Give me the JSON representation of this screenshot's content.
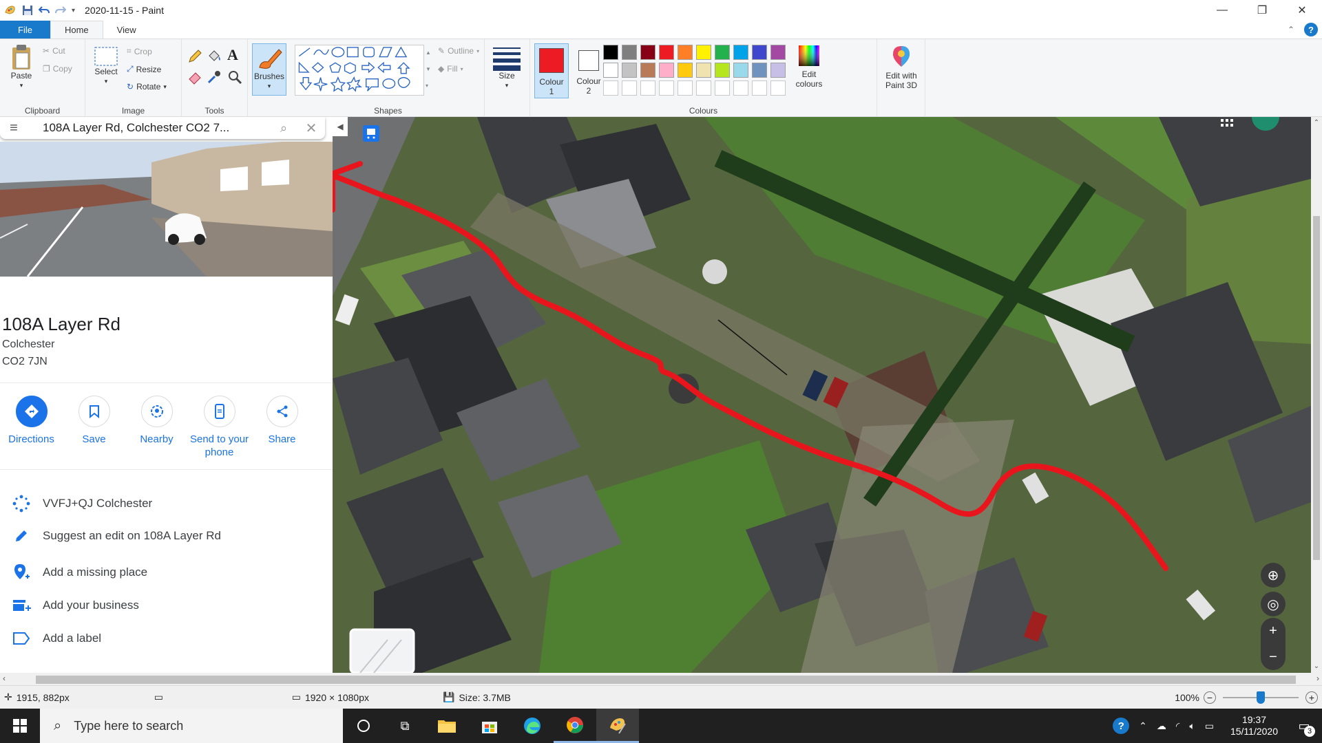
{
  "window": {
    "title": "2020-11-15 - Paint",
    "controls": [
      "—",
      "❐",
      "✕"
    ]
  },
  "tabs": {
    "file": "File",
    "home": "Home",
    "view": "View"
  },
  "ribbon": {
    "clipboard": {
      "label": "Clipboard",
      "paste": "Paste",
      "cut": "Cut",
      "copy": "Copy"
    },
    "image": {
      "label": "Image",
      "select": "Select",
      "crop": "Crop",
      "resize": "Resize",
      "rotate": "Rotate"
    },
    "tools": {
      "label": "Tools"
    },
    "brushes": "Brushes",
    "shapes": {
      "label": "Shapes",
      "outline": "Outline",
      "fill": "Fill"
    },
    "size": "Size",
    "colours": {
      "label": "Colours",
      "colour1_a": "Colour",
      "colour1_b": "1",
      "colour2_a": "Colour",
      "colour2_b": "2",
      "edit_a": "Edit",
      "edit_b": "colours",
      "paint3d_a": "Edit with",
      "paint3d_b": "Paint 3D",
      "colour1_value": "#ed1c24",
      "colour2_value": "#ffffff",
      "palette_row1": [
        "#000000",
        "#7f7f7f",
        "#880015",
        "#ed1c24",
        "#ff7f27",
        "#fff200",
        "#22b14c",
        "#00a2e8",
        "#3f48cc",
        "#a349a4"
      ],
      "palette_row2": [
        "#ffffff",
        "#c3c3c3",
        "#b97a57",
        "#ffaec9",
        "#ffc90e",
        "#efe4b0",
        "#b5e61d",
        "#99d9ea",
        "#7092be",
        "#c8bfe7"
      ]
    }
  },
  "maps": {
    "search_value": "108A Layer Rd, Colchester CO2 7...",
    "place_name": "108A Layer Rd",
    "town": "Colchester",
    "postcode": "CO2 7JN",
    "actions": [
      {
        "label": "Directions"
      },
      {
        "label": "Save"
      },
      {
        "label": "Nearby"
      },
      {
        "label": "Send to your phone"
      },
      {
        "label": "Share"
      }
    ],
    "list": [
      {
        "label": "VVFJ+QJ Colchester"
      },
      {
        "label": "Suggest an edit on 108A Layer Rd"
      },
      {
        "label": "Add a missing place"
      },
      {
        "label": "Add your business"
      },
      {
        "label": "Add a label"
      }
    ],
    "accent": "#1a73e8"
  },
  "status": {
    "cursor": "1915, 882px",
    "dimensions": "1920 × 1080px",
    "size": "Size: 3.7MB",
    "zoom": "100%",
    "zoom_level": 0.5
  },
  "taskbar": {
    "search_placeholder": "Type here to search",
    "time": "19:37",
    "date": "15/11/2020",
    "notifications": "3"
  },
  "annotation_color": "#e8161c"
}
